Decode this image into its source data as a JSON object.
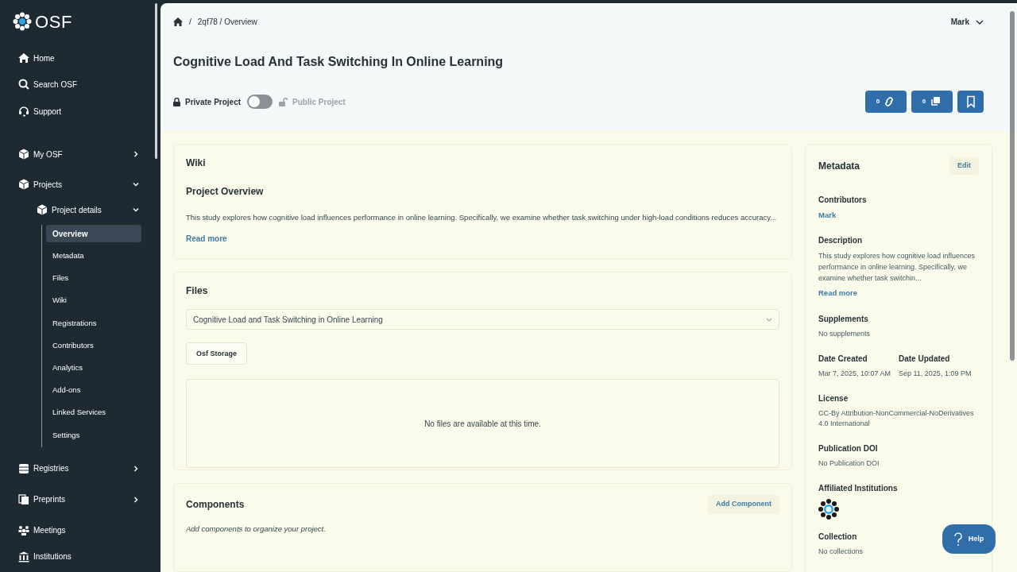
{
  "sidebar": {
    "logo_text": "OSF",
    "items": [
      {
        "label": "Home"
      },
      {
        "label": "Search OSF"
      },
      {
        "label": "Support"
      },
      {
        "label": "My OSF",
        "expanded": false
      },
      {
        "label": "Projects",
        "expanded": true,
        "children": [
          {
            "label": "Project details",
            "expanded": true,
            "children": [
              {
                "label": "Overview",
                "selected": true
              },
              {
                "label": "Metadata",
                "selected": false
              },
              {
                "label": "Files",
                "selected": false
              },
              {
                "label": "Wiki",
                "selected": false
              },
              {
                "label": "Registrations",
                "selected": false
              },
              {
                "label": "Contributors",
                "selected": false
              },
              {
                "label": "Analytics",
                "selected": false
              },
              {
                "label": "Add-ons",
                "selected": false
              },
              {
                "label": "Linked Services",
                "selected": false
              },
              {
                "label": "Settings",
                "selected": false
              }
            ]
          }
        ]
      },
      {
        "label": "Registries",
        "expanded": false
      },
      {
        "label": "Preprints",
        "expanded": false
      },
      {
        "label": "Meetings"
      },
      {
        "label": "Institutions"
      }
    ]
  },
  "breadcrumb": {
    "separator": "/",
    "path": "2qf78 / Overview"
  },
  "user_menu": "Mark",
  "title": "Cognitive Load And Task Switching In Online Learning",
  "visibility": {
    "private_label": "Private Project",
    "public_label": "Public Project",
    "public": false
  },
  "action_buttons": [
    {
      "kind": "links",
      "count": "0"
    },
    {
      "kind": "forks",
      "count": "0"
    },
    {
      "kind": "bookmark"
    }
  ],
  "wiki": {
    "heading": "Wiki",
    "subtitle": "Project Overview",
    "text": "This study explores how cognitive load influences performance in online learning. Specifically, we examine whether task switching under high-load conditions reduces accuracy...",
    "read_more": "Read more"
  },
  "files": {
    "heading": "Files",
    "selected_project": "Cognitive Load and Task Switching in Online Learning",
    "storage_button": "Osf Storage",
    "empty_message": "No files are available at this time."
  },
  "components": {
    "heading": "Components",
    "add_button": "Add Component",
    "hint": "Add components to organize your project."
  },
  "metadata": {
    "heading": "Metadata",
    "edit_button": "Edit",
    "contributors": {
      "label": "Contributors",
      "names": [
        "Mark"
      ]
    },
    "description": {
      "label": "Description",
      "text": "This study explores how cognitive load influences performance in online learning. Specifically, we examine whether task switchin...",
      "read_more": "Read more"
    },
    "supplements": {
      "label": "Supplements",
      "value": "No supplements"
    },
    "dates": [
      {
        "label": "Date Created",
        "value": "Mar 7, 2025, 10:07 AM"
      },
      {
        "label": "Date Updated",
        "value": "Sep 11, 2025, 1:09 PM"
      }
    ],
    "license": {
      "label": "License",
      "value": "CC-By Attribution-NonCommercial-NoDerivatives 4.0 International"
    },
    "doi": {
      "label": "Publication DOI",
      "value": "No Publication DOI"
    },
    "institutions": {
      "label": "Affiliated Institutions"
    },
    "collection": {
      "label": "Collection",
      "value": "No collections"
    }
  },
  "help_button": "Help"
}
